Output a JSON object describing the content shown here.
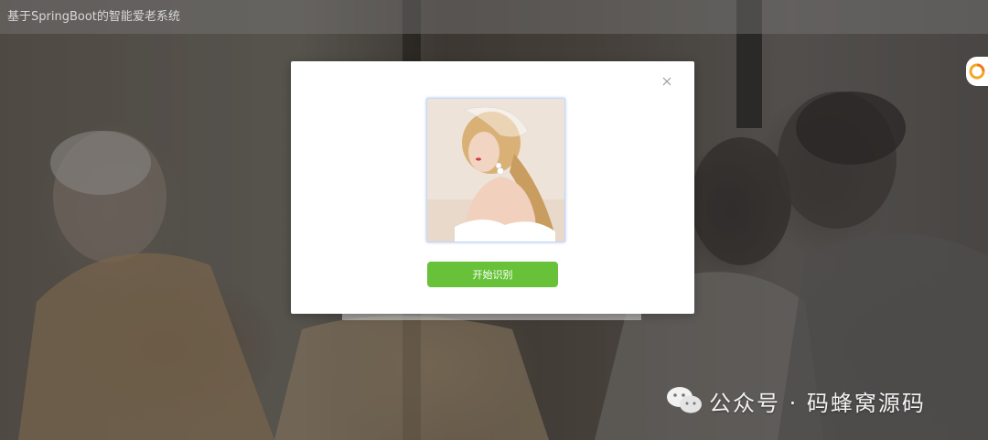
{
  "app": {
    "title": "基于SpringBoot的智能爱老系统"
  },
  "modal": {
    "close_icon": "close-icon",
    "preview_alt": "uploaded-photo",
    "start_button_label": "开始识别"
  },
  "watermark": {
    "icon": "wechat-icon",
    "text": "公众号 · 码蜂窝源码"
  },
  "side_widget": {
    "icon": "circular-logo-icon"
  },
  "colors": {
    "accent_green": "#67c23a",
    "header_overlay": "#787878",
    "modal_bg": "#ffffff"
  }
}
